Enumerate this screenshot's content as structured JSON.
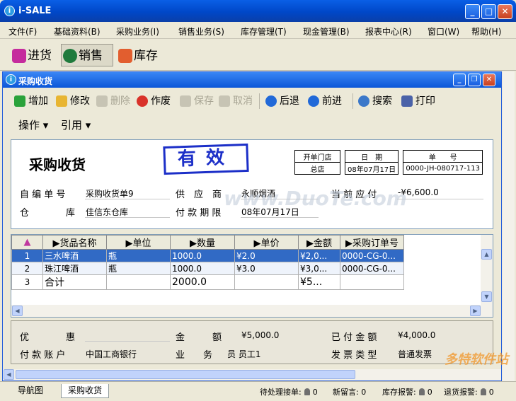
{
  "app": {
    "title": "i-SALE",
    "min": "_",
    "max": "□",
    "close": "✕"
  },
  "menu": [
    "文件(F)",
    "基础资料(B)",
    "采购业务(I)",
    "销售业务(S)",
    "库存管理(T)",
    "现金管理(B)",
    "报表中心(R)",
    "窗口(W)",
    "帮助(H)"
  ],
  "quick": [
    {
      "label": "进货",
      "icon": "purchase-icon",
      "color": "#c52b9d"
    },
    {
      "label": "销售",
      "icon": "sales-globe-icon",
      "color": "#1f7a3c"
    },
    {
      "label": "库存",
      "icon": "inventory-icon",
      "color": "#e25e2f"
    }
  ],
  "child": {
    "title": "采购收货",
    "min": "_",
    "restore": "❐",
    "close": "✕"
  },
  "toolbar": [
    {
      "label": "增加",
      "icon": "add-icon",
      "color": "#2aa23a",
      "enabled": true
    },
    {
      "label": "修改",
      "icon": "edit-icon",
      "color": "#e8b532",
      "enabled": true
    },
    {
      "label": "删除",
      "icon": "delete-icon",
      "color": "#a8a594",
      "enabled": false
    },
    {
      "label": "作废",
      "icon": "void-icon",
      "color": "#d9322a",
      "enabled": true
    },
    {
      "label": "保存",
      "icon": "save-icon",
      "color": "#a8a594",
      "enabled": false
    },
    {
      "label": "取消",
      "icon": "undo-icon",
      "color": "#a8a594",
      "enabled": false
    },
    {
      "label": "后退",
      "icon": "back-arrow-icon",
      "color": "#2169d8",
      "enabled": true
    },
    {
      "label": "前进",
      "icon": "forward-arrow-icon",
      "color": "#2169d8",
      "enabled": true
    },
    {
      "label": "搜索",
      "icon": "search-icon",
      "color": "#3b78c9",
      "enabled": true
    },
    {
      "label": "打印",
      "icon": "print-icon",
      "color": "#4a62a8",
      "enabled": true
    }
  ],
  "ctx": {
    "operate": "操作 ▾",
    "ref": "引用 ▾"
  },
  "doc": {
    "title": "采购收货",
    "stamp": "有效",
    "ref_headers": [
      "开单门店",
      "日　期",
      "单　　号"
    ],
    "ref_values": [
      "总店",
      "08年07月17日",
      "0000-JH-080717-113"
    ],
    "fields": {
      "self_no_label": "自 编 单 号",
      "self_no": "采购收货单9",
      "supplier_label": "供　应　商",
      "supplier": "永顺烟酒",
      "payable_label": "当 前 应 付",
      "payable": "-¥6,600.0",
      "warehouse_label": "仓　　　　库",
      "warehouse": "佳信东仓库",
      "due_label": "付 款 期 限",
      "due": "08年07月17日"
    }
  },
  "grid": {
    "headers": [
      "▶货品名称",
      "▶单位",
      "▶数量",
      "▶单价",
      "▶金额",
      "▶采购订单号"
    ],
    "rows": [
      {
        "no": "1",
        "name": "三水啤酒",
        "unit": "瓶",
        "qty": "1000.0",
        "price": "¥2.0",
        "amount": "¥2,0...",
        "order": "0000-CG-0..."
      },
      {
        "no": "2",
        "name": "珠江啤酒",
        "unit": "瓶",
        "qty": "1000.0",
        "price": "¥3.0",
        "amount": "¥3,0...",
        "order": "0000-CG-0..."
      },
      {
        "no": "3",
        "name": "合计",
        "unit": "",
        "qty": "2000.0",
        "price": "",
        "amount": "¥5...",
        "order": ""
      }
    ]
  },
  "footer": {
    "discount_label": "优　　　　惠",
    "amount_label": "金　　　额",
    "amount": "¥5,000.0",
    "paid_label": "已 付 金 额",
    "paid": "¥4,000.0",
    "account_label": "付 款 账 户",
    "account": "中国工商银行",
    "staff_label": "业　　务",
    "staff": "员 员工1",
    "invoice_label": "发 票 类 型",
    "invoice": "普通发票"
  },
  "tabs": [
    "导航图",
    "采购收货"
  ],
  "status": [
    {
      "label": "待处理接单:",
      "count": "0"
    },
    {
      "label": "新留言:",
      "count": "0"
    },
    {
      "label": "库存报警:",
      "count": "0"
    },
    {
      "label": "退货报警:",
      "count": "0"
    }
  ],
  "watermark": [
    "www.DuoTe.com",
    "多特软件站"
  ]
}
